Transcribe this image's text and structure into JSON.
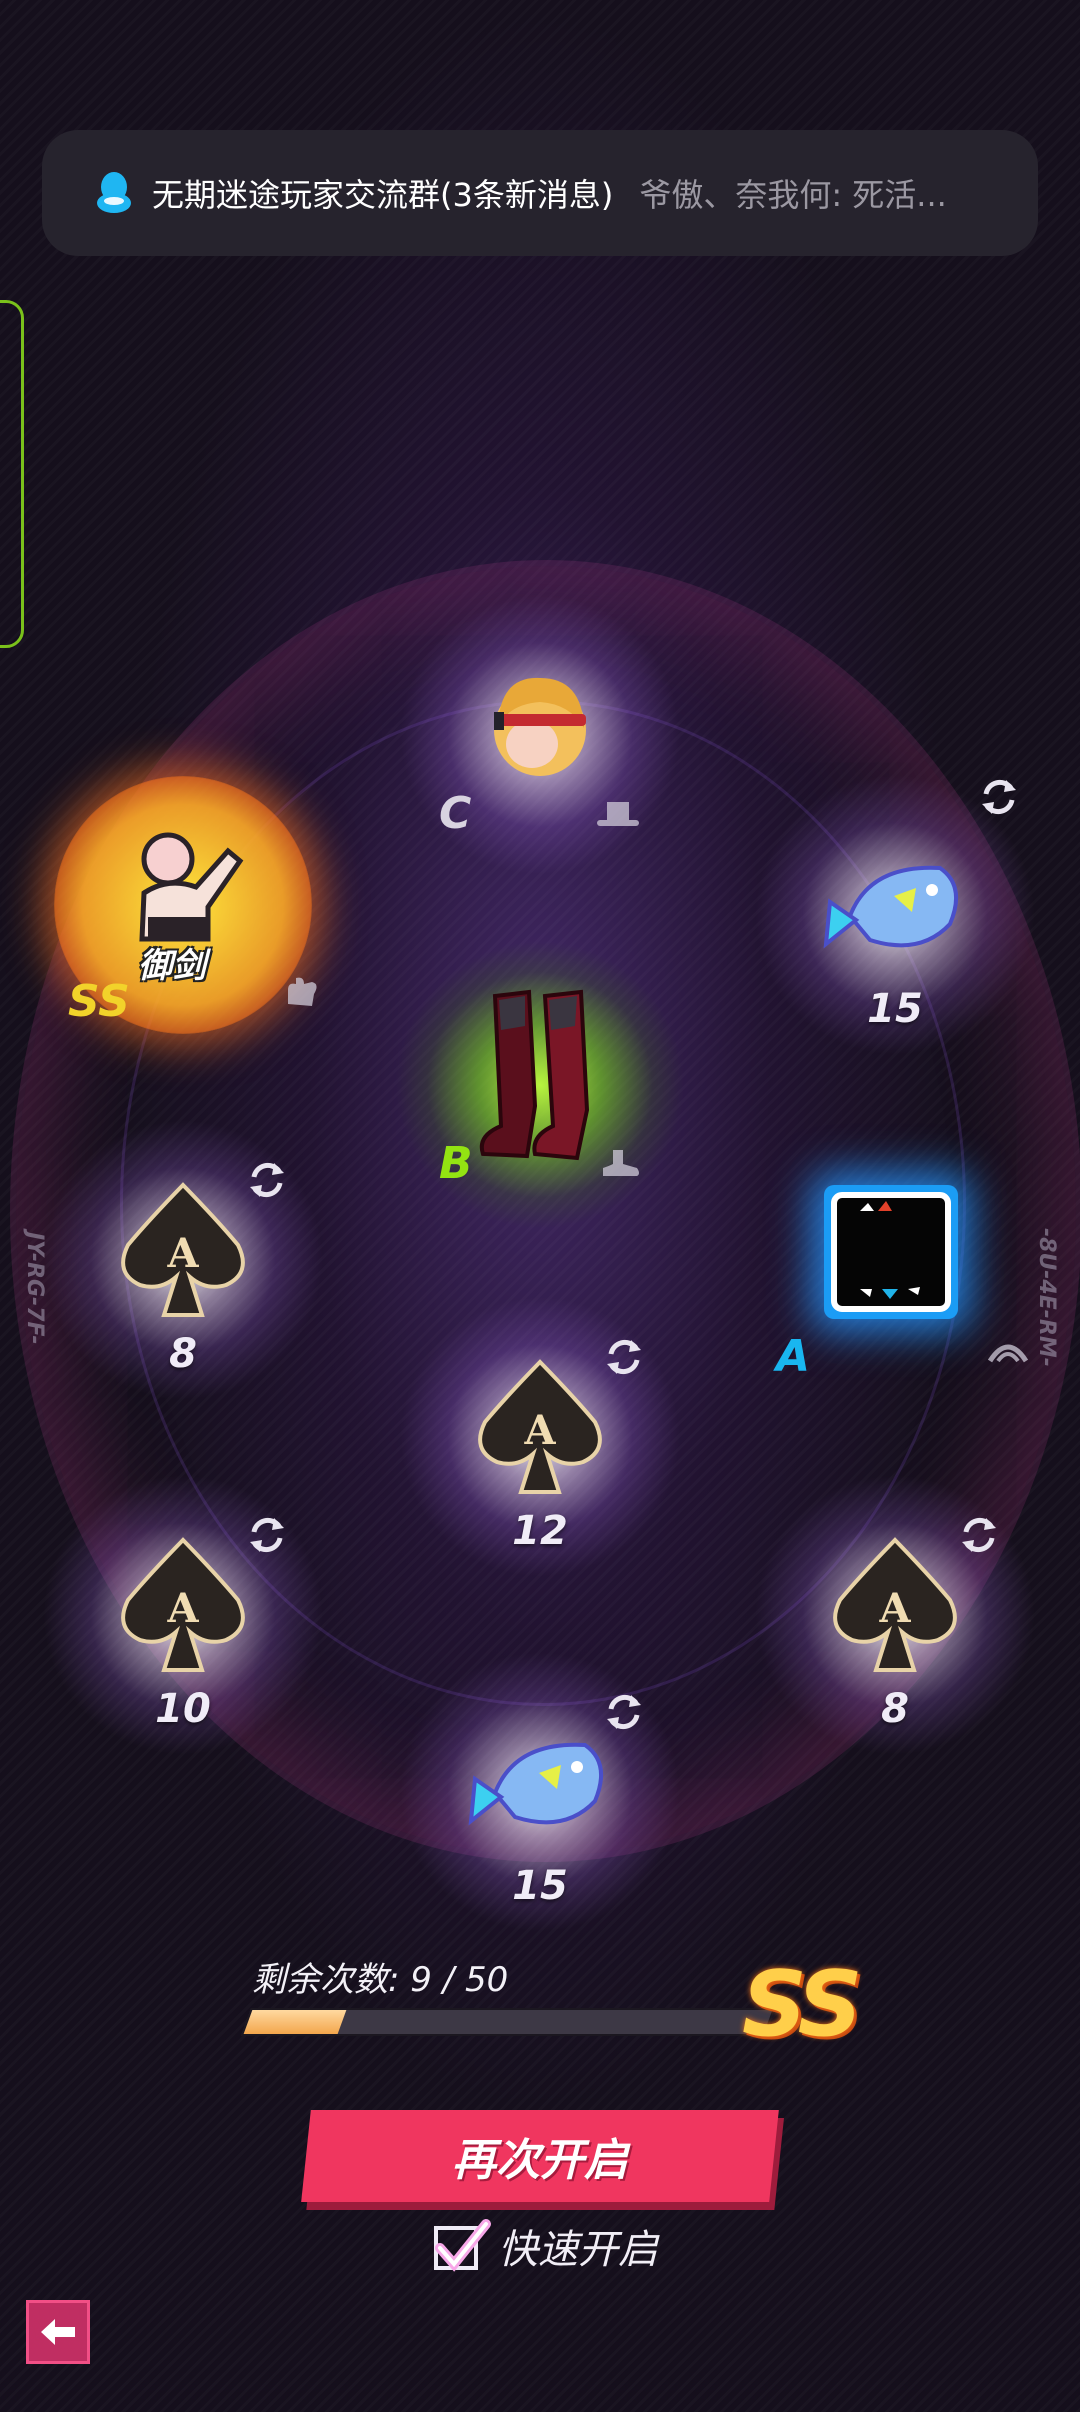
{
  "notification": {
    "group": "无期迷途玩家交流群(3条新消息)",
    "message": "爷傲、奈我何: 死活..."
  },
  "side_codes": {
    "left": "JY-RG-7F-",
    "right": "-8U-4E-RM-"
  },
  "slots": {
    "hat": {
      "grade": "C",
      "item_icon": "blonde-hair-headband-icon",
      "type_icon": "hat-icon"
    },
    "skill": {
      "grade": "SS",
      "item_label": "御剑",
      "item_icon": "figure-skill-icon",
      "type_icon": "glove-icon"
    },
    "fish_top": {
      "count": "15",
      "item_icon": "fish-icon"
    },
    "boots": {
      "grade": "B",
      "item_icon": "boots-icon",
      "type_icon": "shoe-icon"
    },
    "ace_left": {
      "count": "8",
      "item_icon": "spade-ace-icon"
    },
    "box": {
      "grade": "A",
      "item_icon": "black-box-icon",
      "type_icon": "accessory-icon"
    },
    "ace_center": {
      "count": "12",
      "item_icon": "spade-ace-icon"
    },
    "ace_bottom_left": {
      "count": "10",
      "item_icon": "spade-ace-icon"
    },
    "ace_bottom_right": {
      "count": "8",
      "item_icon": "spade-ace-icon"
    },
    "fish_bottom": {
      "count": "15",
      "item_icon": "fish-icon"
    }
  },
  "grade_colors": {
    "SS": "#f2d32a",
    "C": "#d8d3e0",
    "B": "#93e312",
    "A": "#19b6f0"
  },
  "progress": {
    "label": "剩余次数: 9 / 50",
    "used": 9,
    "total": 50,
    "grade": "SS"
  },
  "actions": {
    "open_again": "再次开启",
    "quick_open": "快速开启",
    "quick_checked": true
  }
}
